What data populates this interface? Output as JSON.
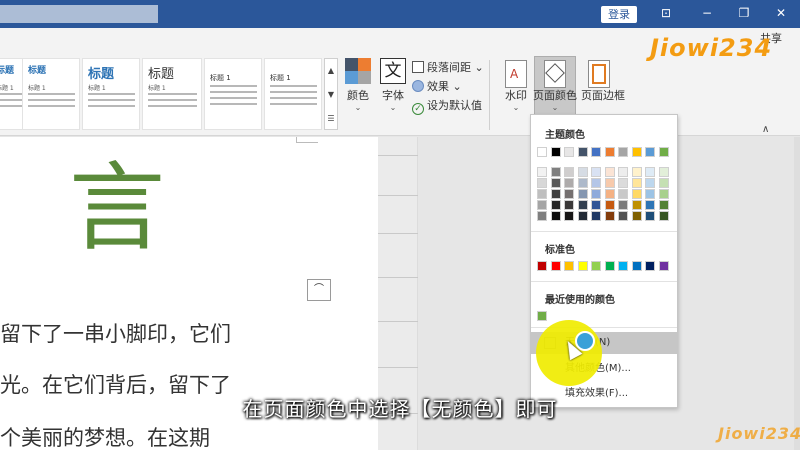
{
  "titlebar": {
    "login_label": "登录",
    "colors": {
      "bar": "#2b579a"
    }
  },
  "ribbon": {
    "style_thumbs": [
      {
        "title": "标题",
        "sub": "标题 1"
      },
      {
        "title": "标题",
        "sub": "标题 1"
      },
      {
        "title": "标题",
        "sub": "标题 1"
      },
      {
        "title": "标题",
        "sub": "标题 1"
      },
      {
        "title": "标题 1",
        "sub": ""
      },
      {
        "title": "标题 1",
        "sub": ""
      }
    ],
    "colors_label": "颜色",
    "font_label": "字体",
    "font_icon_glyph": "文",
    "paragraph_spacing_label": "段落间距",
    "effects_label": "效果",
    "set_default_label": "设为默认值",
    "watermark_label": "水印",
    "page_color_label": "页面颜色",
    "page_border_label": "页面边框",
    "share_label": "共享"
  },
  "document": {
    "big_char": "言",
    "lines": [
      "留下了一串小脚印，它们",
      "光。在它们背后，留下了",
      "个美丽的梦想。在这期"
    ]
  },
  "page_color_menu": {
    "theme_colors_heading": "主题颜色",
    "standard_colors_heading": "标准色",
    "recent_colors_heading": "最近使用的颜色",
    "no_color_label": "无颜色(N)",
    "more_colors_label": "其他颜色(M)...",
    "fill_effects_label": "填充效果(F)...",
    "theme_top_row": [
      "#ffffff",
      "#000000",
      "#e7e6e6",
      "#44546a",
      "#4472c4",
      "#ed7d31",
      "#a5a5a5",
      "#ffc000",
      "#5b9bd5",
      "#70ad47"
    ],
    "theme_shades": [
      [
        "#f2f2f2",
        "#7f7f7f",
        "#d0cece",
        "#d6dce4",
        "#d9e2f3",
        "#fbe4d5",
        "#ededed",
        "#fff2cc",
        "#deebf6",
        "#e2efd9"
      ],
      [
        "#d8d8d8",
        "#595959",
        "#aeabab",
        "#adb9ca",
        "#b4c6e7",
        "#f7caac",
        "#dbdbdb",
        "#ffe599",
        "#bdd7ee",
        "#c5e0b3"
      ],
      [
        "#bfbfbf",
        "#3f3f3f",
        "#757070",
        "#8496b0",
        "#8eaadb",
        "#f4b183",
        "#c9c9c9",
        "#ffd965",
        "#9cc3e5",
        "#a8d08d"
      ],
      [
        "#a5a5a5",
        "#262626",
        "#3a3838",
        "#323f4f",
        "#2f5496",
        "#c55a11",
        "#7b7b7b",
        "#bf9000",
        "#2e75b5",
        "#538135"
      ],
      [
        "#7f7f7f",
        "#0c0c0c",
        "#171616",
        "#222a35",
        "#1f3864",
        "#833c0b",
        "#525252",
        "#7f6000",
        "#1e4e79",
        "#375623"
      ]
    ],
    "standard_colors": [
      "#c00000",
      "#ff0000",
      "#ffc000",
      "#ffff00",
      "#92d050",
      "#00b050",
      "#00b0f0",
      "#0070c0",
      "#002060",
      "#7030a0"
    ],
    "recent_colors": [
      "#70ad47"
    ]
  },
  "subtitle": "在页面颜色中选择【无颜色】即可",
  "watermark_text": "Jiowi234"
}
